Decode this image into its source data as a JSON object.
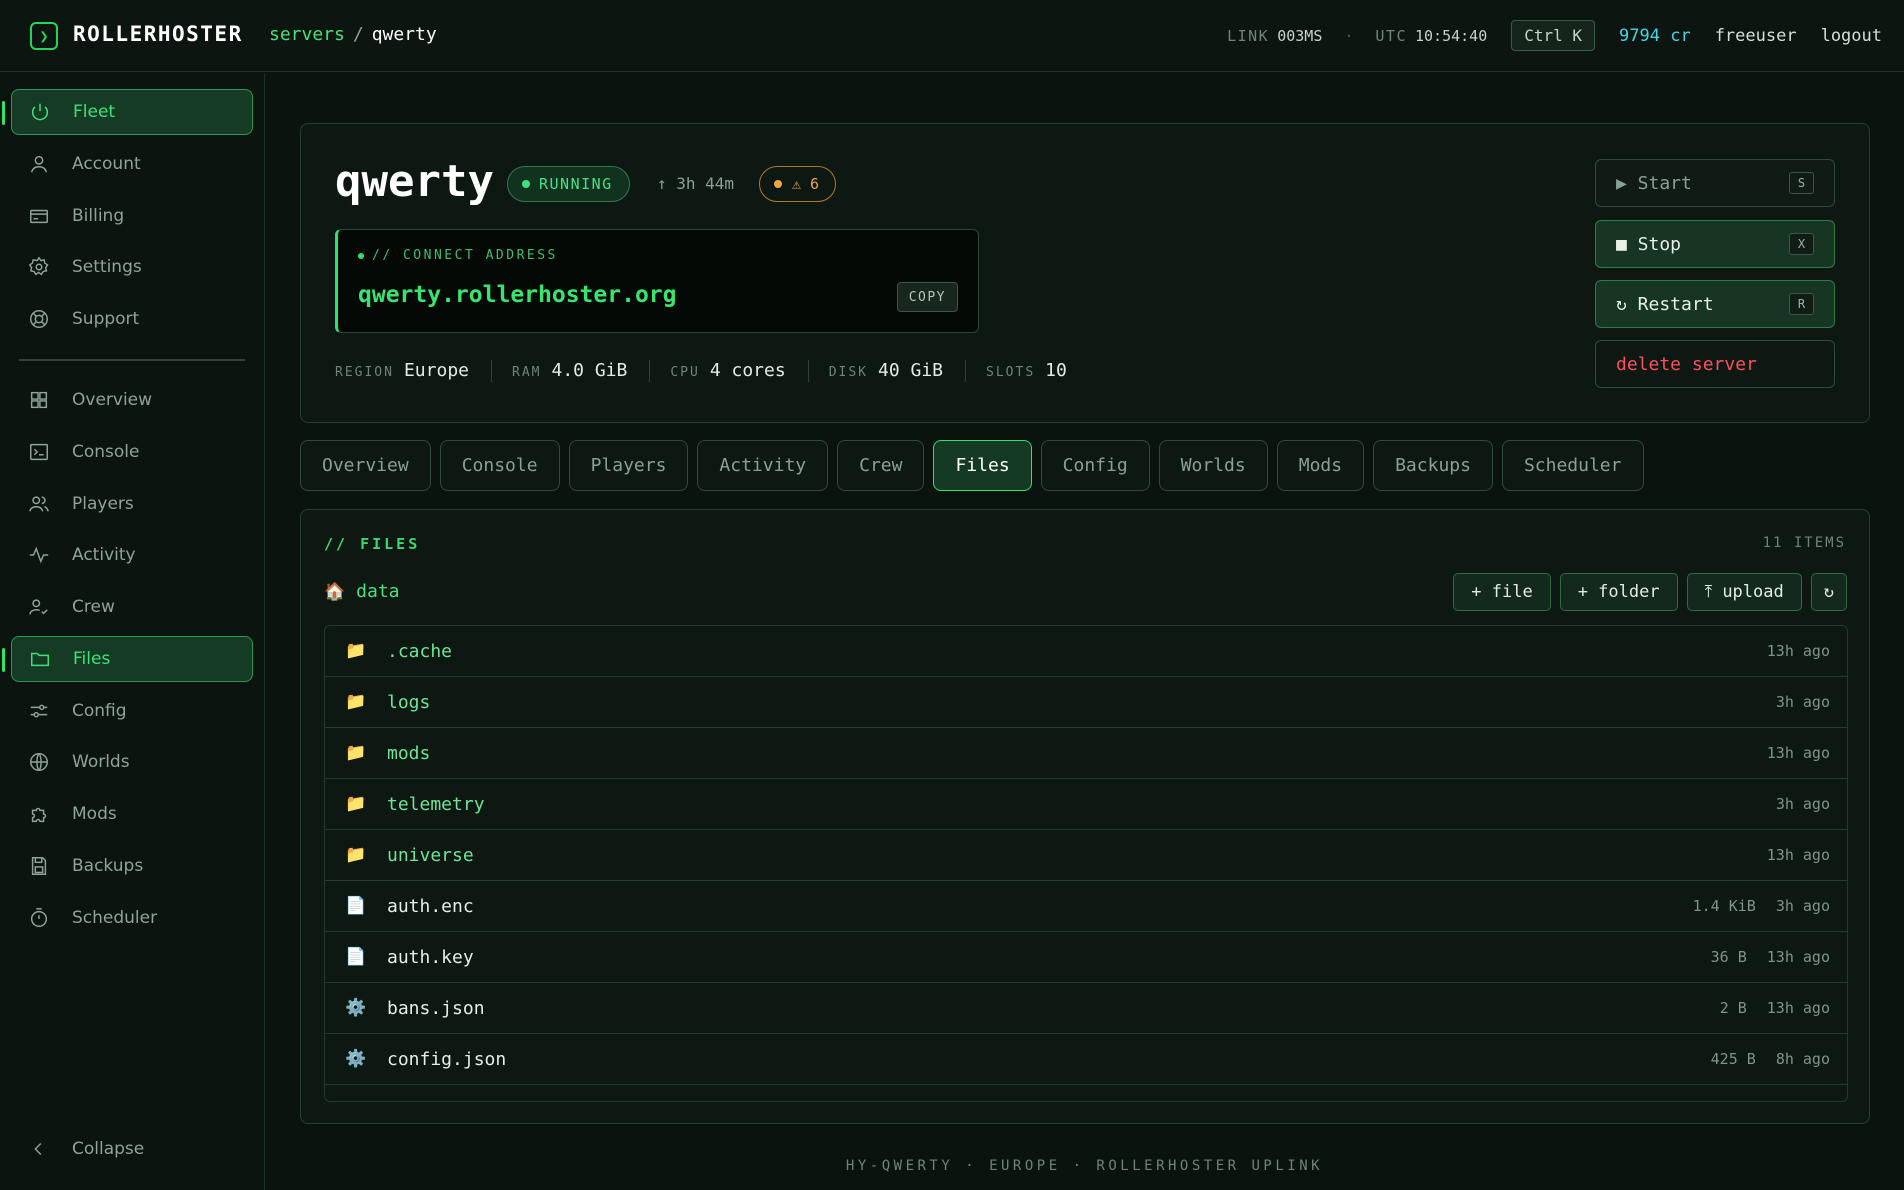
{
  "topbar": {
    "brand": "ROLLERHOSTER",
    "logo_glyph": "❯",
    "breadcrumb": {
      "parent": "servers",
      "separator": "/",
      "current": "qwerty"
    },
    "link_label": "LINK",
    "link_value": "003MS",
    "sep_dot": "·",
    "utc_label": "UTC",
    "utc_value": "10:54:40",
    "shortcut": "Ctrl K",
    "credits": "9794 cr",
    "user": "freeuser",
    "logout": "logout"
  },
  "sidebar": {
    "primary": [
      {
        "label": "Fleet",
        "icon": "power-icon",
        "active": true
      },
      {
        "label": "Account",
        "icon": "user-icon"
      },
      {
        "label": "Billing",
        "icon": "card-icon"
      },
      {
        "label": "Settings",
        "icon": "gear-icon"
      },
      {
        "label": "Support",
        "icon": "lifebuoy-icon"
      }
    ],
    "secondary": [
      {
        "label": "Overview",
        "icon": "grid-icon"
      },
      {
        "label": "Console",
        "icon": "terminal-icon"
      },
      {
        "label": "Players",
        "icon": "users-icon"
      },
      {
        "label": "Activity",
        "icon": "pulse-icon"
      },
      {
        "label": "Crew",
        "icon": "user-check-icon"
      },
      {
        "label": "Files",
        "icon": "folder-icon",
        "active": true
      },
      {
        "label": "Config",
        "icon": "sliders-icon"
      },
      {
        "label": "Worlds",
        "icon": "globe-icon"
      },
      {
        "label": "Mods",
        "icon": "puzzle-icon"
      },
      {
        "label": "Backups",
        "icon": "save-icon"
      },
      {
        "label": "Scheduler",
        "icon": "timer-icon"
      }
    ],
    "collapse": "Collapse"
  },
  "server": {
    "name": "qwerty",
    "status": "RUNNING",
    "uptime": "↑ 3h 44m",
    "warnings": "⚠ 6",
    "connect_label": "// CONNECT ADDRESS",
    "connect_address": "qwerty.rollerhoster.org",
    "copy": "COPY",
    "specs": [
      {
        "label": "REGION",
        "value": "Europe"
      },
      {
        "label": "RAM",
        "value": "4.0 GiB"
      },
      {
        "label": "CPU",
        "value": "4 cores"
      },
      {
        "label": "DISK",
        "value": "40 GiB"
      },
      {
        "label": "SLOTS",
        "value": "10"
      }
    ],
    "actions": {
      "start": {
        "label": "▶ Start",
        "key": "S"
      },
      "stop": {
        "label": "■ Stop",
        "key": "X"
      },
      "restart": {
        "label": "↻ Restart",
        "key": "R"
      },
      "delete": "delete server"
    }
  },
  "tabs": [
    "Overview",
    "Console",
    "Players",
    "Activity",
    "Crew",
    "Files",
    "Config",
    "Worlds",
    "Mods",
    "Backups",
    "Scheduler"
  ],
  "active_tab": "Files",
  "files": {
    "title": "// FILES",
    "count": "11 ITEMS",
    "path": "data",
    "home_glyph": "🏠",
    "actions": {
      "new_file": "+ file",
      "new_folder": "+ folder",
      "upload": "⤒ upload",
      "refresh": "↻"
    },
    "rows": [
      {
        "type": "dir",
        "glyph": "📁",
        "name": ".cache",
        "size": "",
        "modified": "13h ago"
      },
      {
        "type": "dir",
        "glyph": "📁",
        "name": "logs",
        "size": "",
        "modified": "3h ago"
      },
      {
        "type": "dir",
        "glyph": "📁",
        "name": "mods",
        "size": "",
        "modified": "13h ago"
      },
      {
        "type": "dir",
        "glyph": "📁",
        "name": "telemetry",
        "size": "",
        "modified": "3h ago"
      },
      {
        "type": "dir",
        "glyph": "📁",
        "name": "universe",
        "size": "",
        "modified": "13h ago"
      },
      {
        "type": "file",
        "glyph": "📄",
        "name": "auth.enc",
        "size": "1.4 KiB",
        "modified": "3h ago"
      },
      {
        "type": "file",
        "glyph": "📄",
        "name": "auth.key",
        "size": "36 B",
        "modified": "13h ago"
      },
      {
        "type": "file",
        "glyph": "⚙️",
        "name": "bans.json",
        "size": "2 B",
        "modified": "13h ago"
      },
      {
        "type": "file",
        "glyph": "⚙️",
        "name": "config.json",
        "size": "425 B",
        "modified": "8h ago"
      }
    ]
  },
  "footer": "HY-QWERTY · EUROPE · ROLLERHOSTER UPLINK",
  "colors": {
    "accent": "#2ee36b",
    "danger": "#ff4f5e",
    "warning": "#f0a63a",
    "credits": "#3fd6e6"
  }
}
